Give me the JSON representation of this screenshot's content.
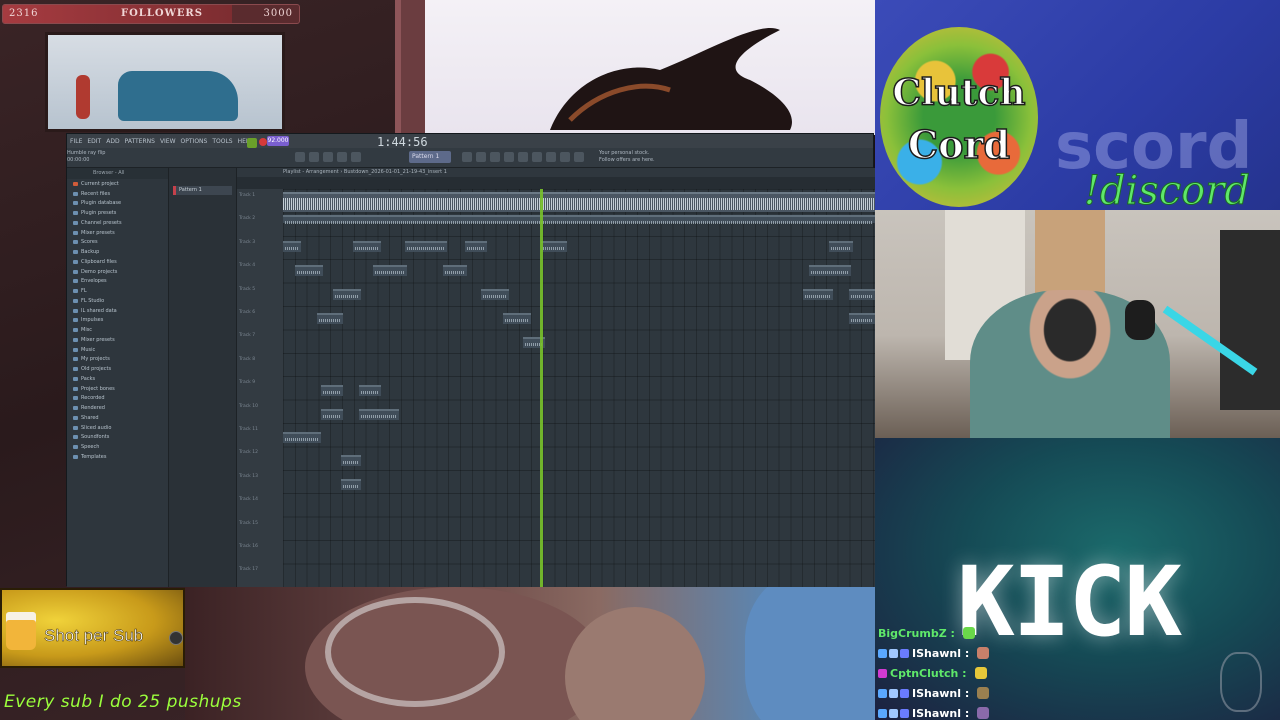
{
  "followers": {
    "current": "2316",
    "label": "FOLLOWERS",
    "goal": "3000",
    "progress_fraction": 0.772
  },
  "fl": {
    "menu": [
      "FILE",
      "EDIT",
      "ADD",
      "PATTERNS",
      "VIEW",
      "OPTIONS",
      "TOOLS",
      "HELP"
    ],
    "time": "1:44:56",
    "tempo": "92.000",
    "pattern": "Pattern 1",
    "hint_right": "Your personal stock. Follow offers are here.",
    "hint_left": "Humble ray flip 00:00:00",
    "browser_title": "Browser - All",
    "browser_items": [
      "Current project",
      "Recent files",
      "Plugin database",
      "Plugin presets",
      "Channel presets",
      "Mixer presets",
      "Scores",
      "Backup",
      "Clipboard files",
      "Demo projects",
      "Envelopes",
      "FL",
      "FL Studio",
      "IL shared data",
      "Impulses",
      "Misc",
      "Mixer presets",
      "Music",
      "My projects",
      "Old projects",
      "Packs",
      "Project bones",
      "Recorded",
      "Rendered",
      "Shared",
      "Sliced audio",
      "Soundfonts",
      "Speech",
      "Templates"
    ],
    "channel_pattern": "Pattern 1",
    "playlist_title": "Playlist - Arrangement › Bustdown_2026-01-01_21-19-43_insert 1",
    "tracks": [
      "Track 1",
      "Track 2",
      "Track 3",
      "Track 4",
      "Track 5",
      "Track 6",
      "Track 7",
      "Track 8",
      "Track 9",
      "Track 10",
      "Track 11",
      "Track 12",
      "Track 13",
      "Track 14",
      "Track 15",
      "Track 16",
      "Track 17"
    ]
  },
  "discord": {
    "logo_line1": "Clutch",
    "logo_line2": "Cord",
    "bg_word": "scord",
    "command": "!discord"
  },
  "kick": {
    "word": "KICK"
  },
  "chat": [
    {
      "name": "BigCrumbZ :",
      "color": "#5fe86a",
      "badges": [],
      "emote": "#6ad84a"
    },
    {
      "name": "IShawnl :",
      "color": "#ffffff",
      "badges": [
        "#5aa8ff",
        "#a0c8ff",
        "#6a7cff"
      ],
      "emote": "#c8806a"
    },
    {
      "name": "CptnClutch :",
      "color": "#5fe86a",
      "badges": [
        "#d23ad2"
      ],
      "emote": "#e6c83a"
    },
    {
      "name": "IShawnl :",
      "color": "#ffffff",
      "badges": [
        "#5aa8ff",
        "#a0c8ff",
        "#6a7cff"
      ],
      "emote": "#9a8050"
    },
    {
      "name": "IShawnl :",
      "color": "#ffffff",
      "badges": [
        "#5aa8ff",
        "#a0c8ff",
        "#6a7cff"
      ],
      "emote": "#8a6aaa"
    }
  ],
  "shot": {
    "label": "Shot per Sub"
  },
  "pushups": "Every sub I do 25 pushups"
}
